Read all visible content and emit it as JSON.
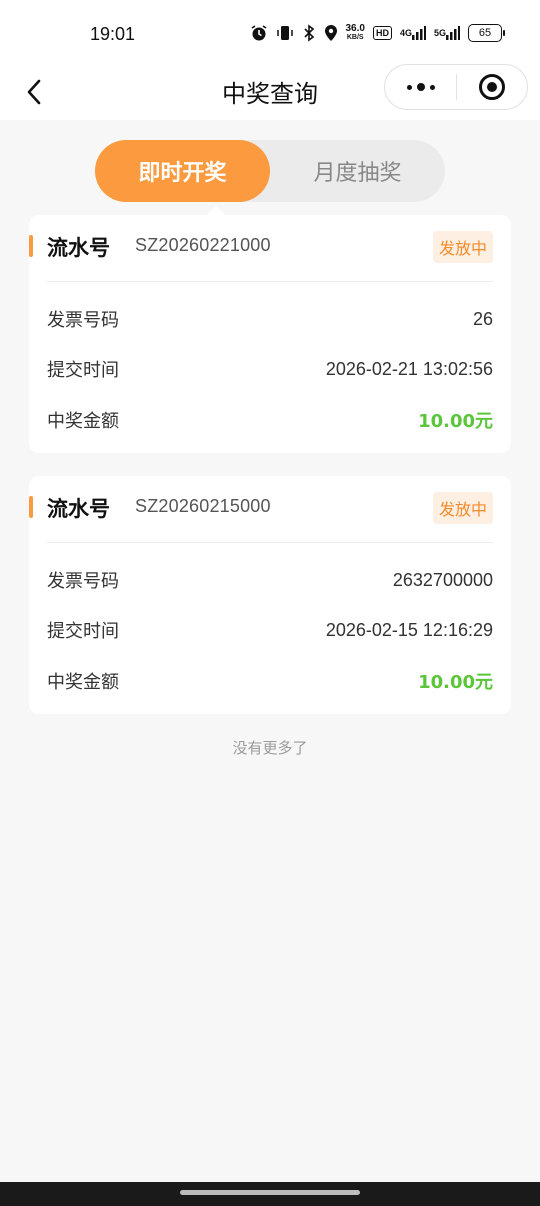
{
  "status": {
    "time": "19:01",
    "speed_value": "36.0",
    "speed_unit": "KB/S",
    "hd_label": "HD",
    "net1": "4G",
    "net2": "5G",
    "battery": "65"
  },
  "nav": {
    "title": "中奖查询",
    "back_icon": "chevron-left-icon",
    "more_icon": "more-dots-icon",
    "close_icon": "target-icon"
  },
  "tabs": [
    {
      "label": "即时开奖",
      "active": true
    },
    {
      "label": "月度抽奖",
      "active": false
    }
  ],
  "records": [
    {
      "serial_label": "流水号",
      "serial_value": "SZ20260221000",
      "status": "发放中",
      "rows": [
        {
          "label": "发票号码",
          "value": "26"
        },
        {
          "label": "提交时间",
          "value": "2026-02-21 13:02:56"
        },
        {
          "label": "中奖金额",
          "value": "10.00元"
        }
      ]
    },
    {
      "serial_label": "流水号",
      "serial_value": "SZ20260215000",
      "status": "发放中",
      "rows": [
        {
          "label": "发票号码",
          "value": "2632700000"
        },
        {
          "label": "提交时间",
          "value": "2026-02-15 12:16:29"
        },
        {
          "label": "中奖金额",
          "value": "10.00元"
        }
      ]
    }
  ],
  "footer": {
    "no_more": "没有更多了"
  },
  "colors": {
    "accent": "#fb9a3e",
    "amount": "#5cc63b",
    "badge_text": "#f58a2b",
    "badge_bg": "#fdf0e3"
  }
}
